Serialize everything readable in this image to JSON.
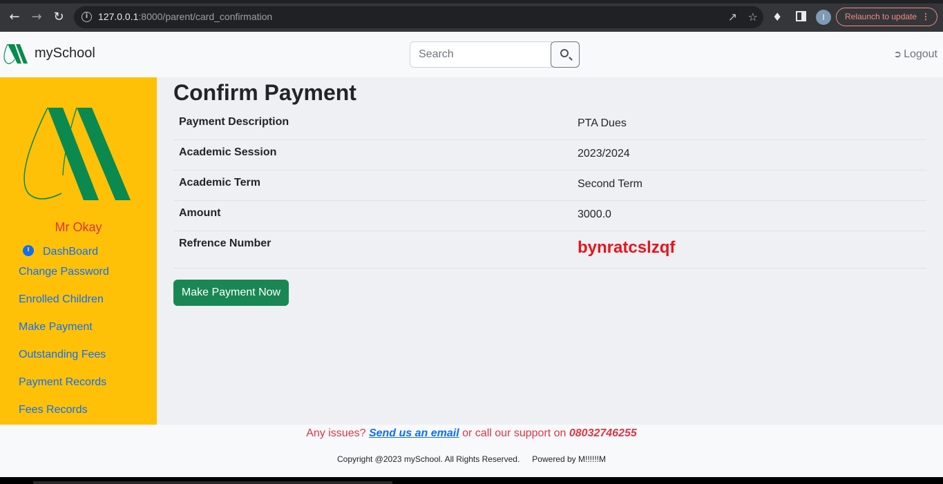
{
  "browser": {
    "url_host": "127.0.0.1",
    "url_rest": ":8000/parent/card_confirmation",
    "profile_initial": "I",
    "relaunch_label": "Relaunch to update"
  },
  "navbar": {
    "brand": "mySchool",
    "search_placeholder": "Search",
    "logout_label": "Logout"
  },
  "sidebar": {
    "user_name": "Mr Okay",
    "dashboard_label": "DashBoard",
    "links": [
      "Change Password",
      "Enrolled Children",
      "Make Payment",
      "Outstanding Fees",
      "Payment Records",
      "Fees Records"
    ]
  },
  "main": {
    "title": "Confirm Payment",
    "rows": [
      {
        "label": "Payment Description",
        "value": "PTA Dues"
      },
      {
        "label": "Academic Session",
        "value": "2023/2024"
      },
      {
        "label": "Academic Term",
        "value": "Second Term"
      },
      {
        "label": "Amount",
        "value": "3000.0"
      },
      {
        "label": "Refrence Number",
        "value": "bynratcslzqf"
      }
    ],
    "pay_button": "Make Payment Now"
  },
  "footer": {
    "issues_prefix": "Any issues? ",
    "email_link": "Send us an email",
    "issues_middle": " or call our support on ",
    "phone": "08032746255",
    "copyright": "Copyright @2023 mySchool. All Rights Reserved.",
    "powered": "Powered by M!!!!!!M"
  },
  "colors": {
    "sidebar_bg": "#ffc107",
    "logo_green": "#0a8a4e",
    "reference_red": "#e8141c",
    "pay_button": "#198754",
    "link_blue": "#0d6efd"
  }
}
